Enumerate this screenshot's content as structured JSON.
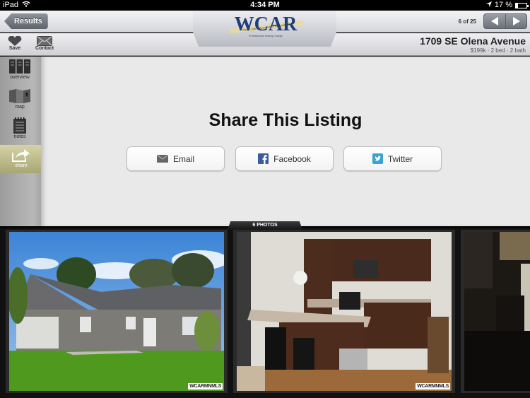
{
  "status_bar": {
    "device": "iPad",
    "time": "4:34 PM",
    "battery_percent": "17 %",
    "battery_level": 0.17
  },
  "nav": {
    "back_label": "Results",
    "pager_text": "6 of 25",
    "prev_icon": "triangle-left-icon",
    "next_icon": "triangle-right-icon"
  },
  "logo": {
    "letters": "WCAR",
    "banner_text": "West Central Association of Realtors",
    "tagline": "Professionals Moving Change"
  },
  "toolbar": {
    "save_label": "Save",
    "contact_label": "Contact"
  },
  "listing": {
    "address": "1709 SE Olena Avenue",
    "summary": "$199k  ·  2 bed  ·  2 bath"
  },
  "sidebar": {
    "items": [
      {
        "label": "overview",
        "icon": "overview-icon",
        "active": false
      },
      {
        "label": "map",
        "icon": "map-icon",
        "active": false
      },
      {
        "label": "notes",
        "icon": "notes-icon",
        "active": false
      },
      {
        "label": "share",
        "icon": "share-icon",
        "active": true
      }
    ]
  },
  "share": {
    "title": "Share This Listing",
    "buttons": [
      {
        "label": "Email",
        "icon": "envelope-icon"
      },
      {
        "label": "Facebook",
        "icon": "facebook-icon"
      },
      {
        "label": "Twitter",
        "icon": "twitter-icon"
      }
    ]
  },
  "photos": {
    "tab_label": "6 PHOTOS",
    "watermark": "WCARMNMLS",
    "items": [
      {
        "description": "House exterior with lawn"
      },
      {
        "description": "Kitchen with island"
      },
      {
        "description": "Dining area"
      }
    ]
  },
  "colors": {
    "accent_active": "#b7b482",
    "nav_button": "#6c7078",
    "strip_background": "#111111"
  }
}
